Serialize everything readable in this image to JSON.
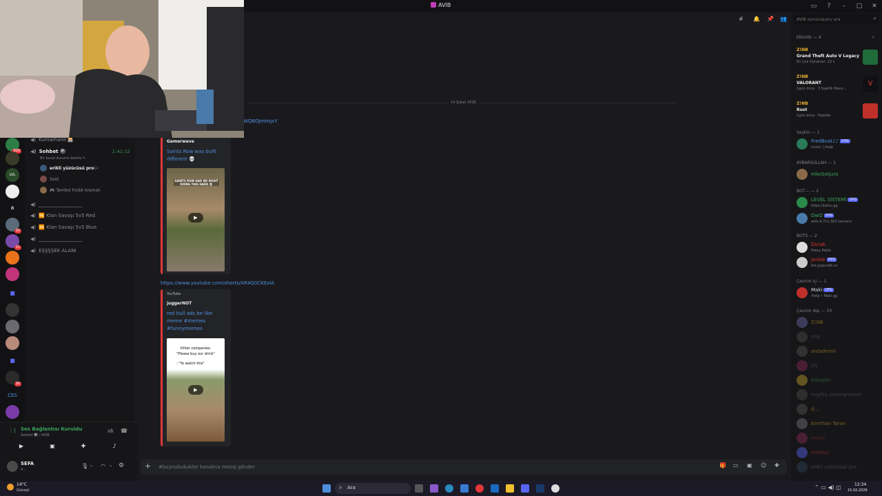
{
  "window": {
    "title": "AVIB"
  },
  "date_divider": "14 Şubat 2026",
  "top_link_fragment": "WQBOJmHqxY",
  "search": {
    "placeholder": "AVIB sunucusunu ara"
  },
  "guild_badges": [
    "929",
    "14",
    "11",
    "16"
  ],
  "guild_text": {
    "letter": "a",
    "ces": "CES"
  },
  "channels": [
    {
      "label": "Kumarhane 🎰",
      "type": "voice"
    },
    {
      "label": "Sohbet 🎱",
      "type": "voice",
      "active": true,
      "timer": "2:41:12",
      "status": "Bir kanal durumu belirle ✎"
    },
    {
      "label": "__________________",
      "type": "voice"
    },
    {
      "label": "🆚 Klan Savaşı 5v5 Red",
      "type": "voice"
    },
    {
      "label": "🆚 Klan Savaşı 5v5 Blue",
      "type": "voice"
    },
    {
      "label": "__________________",
      "type": "voice"
    },
    {
      "label": "EŞŞŞŞEK ALANI",
      "type": "voice"
    }
  ],
  "voice_users": [
    "erikli yüzücüsü pro🎶",
    "Said",
    "🎮 Tambol fındık kremalı"
  ],
  "voice_panel": {
    "status": "Ses Bağlantısı Kuruldu",
    "channel": "Sohbet 🎱 / AVIB"
  },
  "user": {
    "name": "SEFA",
    "status": "9..."
  },
  "embeds": [
    {
      "provider": "",
      "author": "Gamerwave",
      "title": "Saints Row was built different 💀",
      "thumb_text": "SAINTS ROW HAD NO RIGHT DOING THIS HARD 💀"
    },
    {
      "provider": "YouTube",
      "author": "juggerNOT",
      "title": "red bull ads be like meme #memes #funnymemes",
      "thumb_line1": "Other companies:",
      "thumb_line2": "\"Please buy our drink\"",
      "thumb_line3": ": \"Yo watch this\""
    }
  ],
  "message_link": "https://www.youtube.com/shorts/AR4Q0CKEolA",
  "composer": {
    "placeholder": "#boynubukukler kanalına mesaj gönder"
  },
  "members": {
    "activity_header": "Etkinlik — 4",
    "activities": [
      {
        "user": "Z!NB",
        "game": "Grand Theft Auto V Legacy",
        "detail": "En Çok Oynanan: 23 s",
        "color": "#1f6b3a"
      },
      {
        "user": "Z!NB",
        "game": "VALORANT",
        "detail": "1gün önce · 3 Saatlik Mara...",
        "color": "#101014"
      },
      {
        "user": "Z!NB",
        "game": "Rust",
        "detail": "1gün önce · Popüler",
        "color": "#c0302b"
      }
    ],
    "groups": [
      {
        "header": "Seçkin — 1",
        "items": [
          {
            "name": "FredBoat♪♪",
            "tag": "UYG",
            "sub": "music | /help",
            "color": "#4e8fdb"
          }
        ]
      },
      {
        "header": "AYBARSULLAH — 1",
        "items": [
          {
            "name": "HikoSeijuro",
            "tag": "",
            "sub": "",
            "color": "#3ba55d"
          }
        ]
      },
      {
        "header": "BOT— — 2",
        "items": [
          {
            "name": "LEVEL SİSTEMİ",
            "tag": "UYG",
            "sub": "https://tatsu.gg",
            "color": "#3ba55d"
          },
          {
            "name": "OwO",
            "tag": "UYG",
            "sub": "with 4,711,303 servers!",
            "color": "#3ba55d"
          }
        ]
      },
      {
        "header": "BOTS — 2",
        "items": [
          {
            "name": "Durak",
            "tag": "",
            "sub": "Petey Pablo",
            "color": "#e23737"
          },
          {
            "name": "Jockie",
            "tag": "UYG",
            "sub": "bot.popcraft.ca",
            "color": "#e23737"
          }
        ]
      },
      {
        "header": "Çevrim içi — 1",
        "items": [
          {
            "name": "Maki",
            "tag": "UYG",
            "sub": "/help • Maki.gg",
            "color": "#dbdee1"
          }
        ]
      }
    ],
    "offline_header": "Çevrim dışı — 33",
    "offline": [
      "Z!NB",
      "Imp",
      "ardademir",
      "sly",
      "babajim",
      "mighty pomegranate",
      "d...",
      "Emirhan Taner",
      "emrel",
      "erenloy",
      "erikli yüzücüsü pro"
    ]
  },
  "taskbar": {
    "weather_temp": "14°C",
    "weather_label": "Güneşli",
    "search": "Ara",
    "time": "12:34",
    "date": "15.02.2026"
  }
}
